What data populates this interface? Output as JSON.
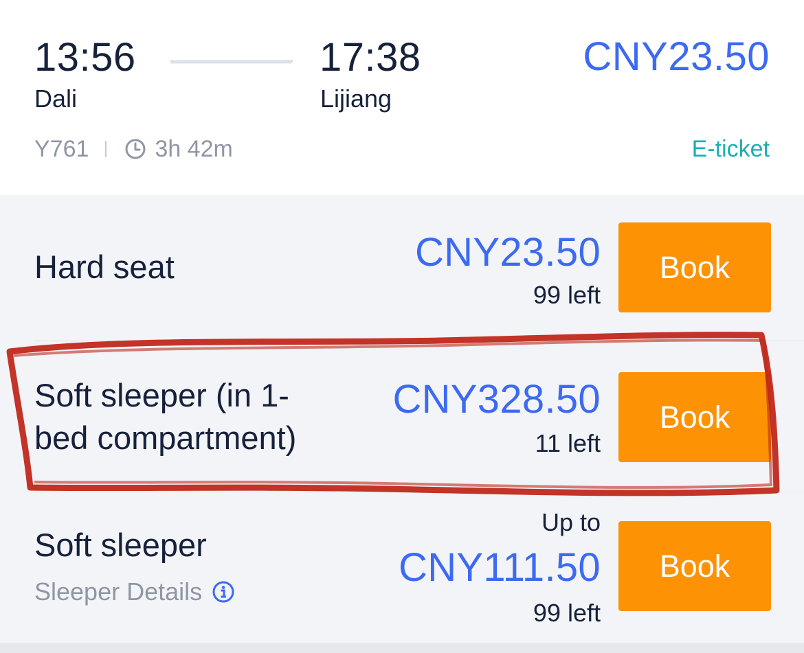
{
  "trip": {
    "departure_time": "13:56",
    "departure_station": "Dali",
    "arrival_time": "17:38",
    "arrival_station": "Lijiang",
    "price": "CNY23.50",
    "train_number": "Y761",
    "duration": "3h 42m",
    "ticket_type": "E-ticket"
  },
  "seats": [
    {
      "name": "Hard seat",
      "price": "CNY23.50",
      "availability": "99 left",
      "book_label": "Book"
    },
    {
      "name_line1": "Soft sleeper (in 1-",
      "name_line2": "bed compartment)",
      "price": "CNY328.50",
      "availability": "11 left",
      "book_label": "Book"
    },
    {
      "name": "Soft sleeper",
      "details_link": "Sleeper Details",
      "price_prefix": "Up to",
      "price": "CNY111.50",
      "availability": "99 left",
      "book_label": "Book"
    }
  ],
  "colors": {
    "price": "#3c6af1",
    "book_button": "#fd9204",
    "eticket": "#19aeb3",
    "annotation": "#c0281c"
  },
  "icons": [
    "arrow-right-icon",
    "clock-icon",
    "info-icon"
  ]
}
